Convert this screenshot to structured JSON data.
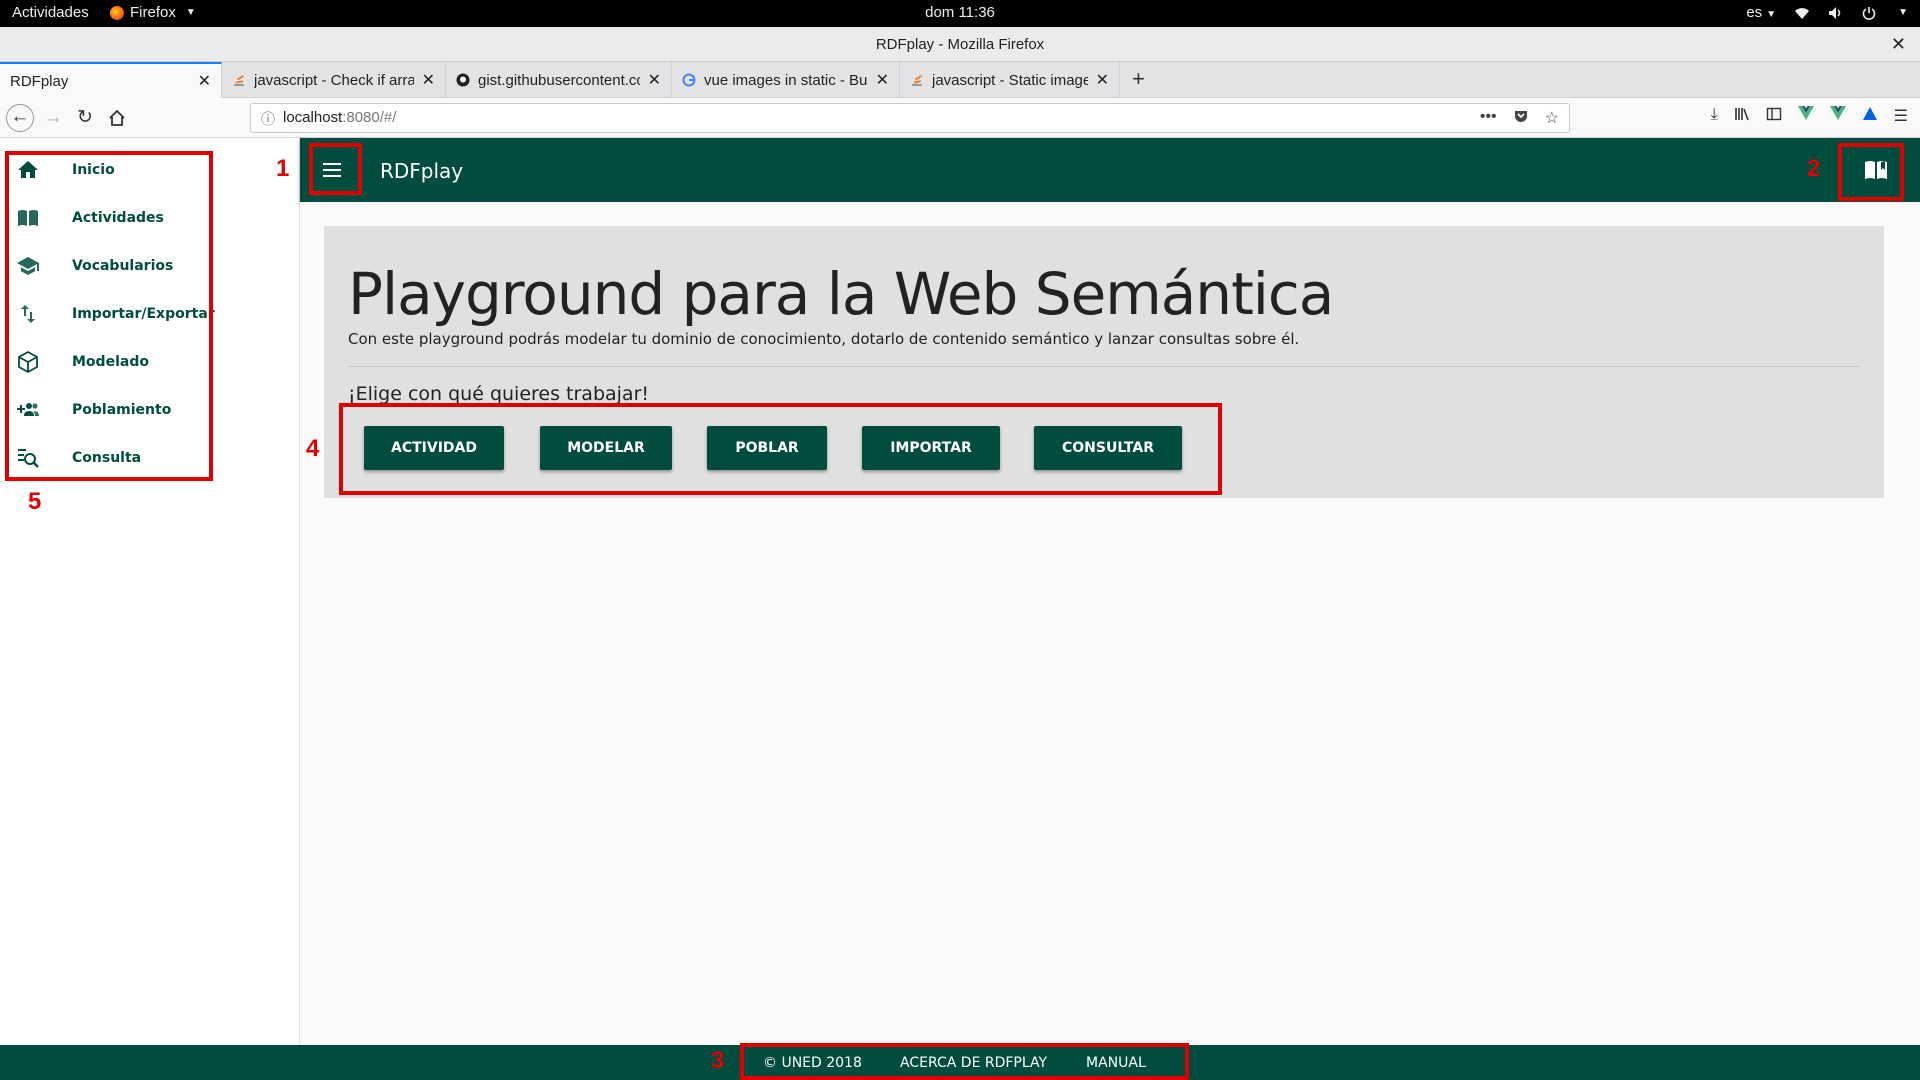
{
  "system_bar": {
    "activities": "Actividades",
    "app_name": "Firefox",
    "clock": "dom 11:36",
    "language": "es"
  },
  "window": {
    "title": "RDFplay - Mozilla Firefox"
  },
  "tabs": [
    {
      "label": "RDFplay"
    },
    {
      "label": "javascript - Check if array"
    },
    {
      "label": "gist.githubusercontent.co"
    },
    {
      "label": "vue images in static - Bus"
    },
    {
      "label": "javascript - Static image s"
    }
  ],
  "url": {
    "host": "localhost",
    "rest": ":8080/#/"
  },
  "sidebar": {
    "items": [
      {
        "label": "Inicio",
        "icon": "home-icon"
      },
      {
        "label": "Actividades",
        "icon": "book-icon"
      },
      {
        "label": "Vocabularios",
        "icon": "school-icon"
      },
      {
        "label": "Importar/Exportar",
        "icon": "import-export-icon"
      },
      {
        "label": "Modelado",
        "icon": "cube-icon"
      },
      {
        "label": "Poblamiento",
        "icon": "group-add-icon"
      },
      {
        "label": "Consulta",
        "icon": "search-icon"
      }
    ]
  },
  "appbar": {
    "title": "RDFplay"
  },
  "hero": {
    "title": "Playground para la Web Semántica",
    "subtitle": "Con este playground podrás modelar tu dominio de conocimiento, dotarlo de contenido semántico y lanzar consultas sobre él.",
    "choose": "¡Elige con qué quieres trabajar!",
    "buttons": [
      "ACTIVIDAD",
      "MODELAR",
      "POBLAR",
      "IMPORTAR",
      "CONSULTAR"
    ]
  },
  "footer": {
    "copyright": "© UNED 2018",
    "about": "ACERCA DE RDFPLAY",
    "manual": "MANUAL"
  },
  "annotations": [
    "1",
    "2",
    "3",
    "4",
    "5"
  ],
  "colors": {
    "primary": "#004d40",
    "annotation": "#e00000"
  }
}
